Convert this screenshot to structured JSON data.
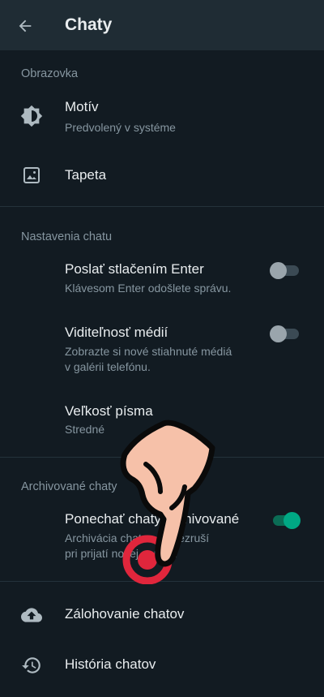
{
  "appbar": {
    "title": "Chaty"
  },
  "display_section": {
    "header": "Obrazovka",
    "theme": {
      "title": "Motív",
      "subtitle": "Predvolený v systéme"
    },
    "wallpaper": {
      "title": "Tapeta"
    }
  },
  "chat_settings": {
    "header": "Nastavenia chatu",
    "enter_send": {
      "title": "Poslať stlačením Enter",
      "subtitle": "Klávesom Enter odošlete správu.",
      "on": false
    },
    "media_visibility": {
      "title": "Viditeľnosť médií",
      "subtitle_line1": "Zobrazte si nové stiahnuté médiá",
      "subtitle_line2": "v galérii telefónu.",
      "on": false
    },
    "font_size": {
      "title": "Veľkosť písma",
      "subtitle": "Stredné"
    }
  },
  "archived_section": {
    "header": "Archivované chaty",
    "keep_archived": {
      "title": "Ponechať chaty archivované",
      "subtitle_line1": "Archivácia chatov sa nezruší",
      "subtitle_line2": "pri prijatí novej správy.",
      "on": true
    }
  },
  "other": {
    "backup": {
      "title": "Zálohovanie chatov"
    },
    "history": {
      "title": "História chatov"
    }
  },
  "colors": {
    "accent": "#00a884",
    "background": "#121b22",
    "appbar": "#1f2c34",
    "secondary_text": "#8696a0"
  }
}
